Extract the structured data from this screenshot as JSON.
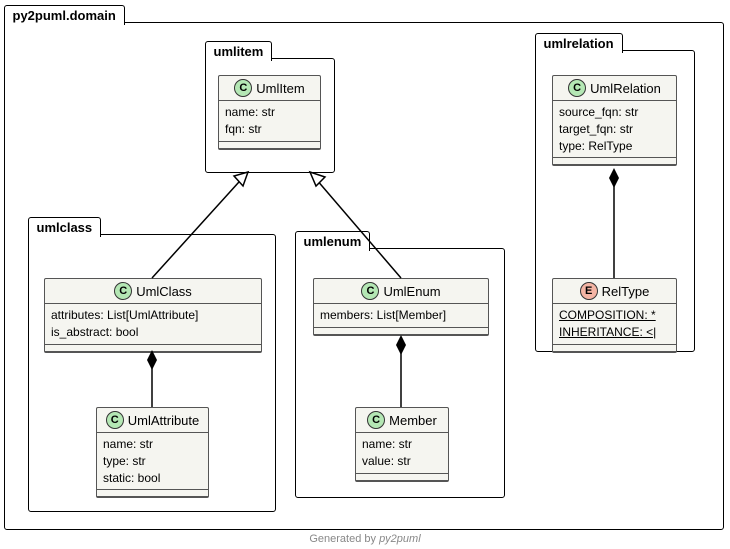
{
  "chart_data": {
    "type": "uml_class_diagram",
    "outer_package": "py2puml.domain",
    "packages": [
      {
        "name": "umlitem",
        "classes": [
          "UmlItem"
        ]
      },
      {
        "name": "umlclass",
        "classes": [
          "UmlClass",
          "UmlAttribute"
        ]
      },
      {
        "name": "umlenum",
        "classes": [
          "UmlEnum",
          "Member"
        ]
      },
      {
        "name": "umlrelation",
        "classes": [
          "UmlRelation",
          "RelType"
        ]
      }
    ],
    "classes": {
      "UmlItem": {
        "stereotype": "C",
        "attributes": [
          "name: str",
          "fqn: str"
        ]
      },
      "UmlClass": {
        "stereotype": "C",
        "attributes": [
          "attributes: List[UmlAttribute]",
          "is_abstract: bool"
        ]
      },
      "UmlAttribute": {
        "stereotype": "C",
        "attributes": [
          "name: str",
          "type: str",
          "static: bool"
        ]
      },
      "UmlEnum": {
        "stereotype": "C",
        "attributes": [
          "members: List[Member]"
        ]
      },
      "Member": {
        "stereotype": "C",
        "attributes": [
          "name: str",
          "value: str"
        ]
      },
      "UmlRelation": {
        "stereotype": "C",
        "attributes": [
          "source_fqn: str",
          "target_fqn: str",
          "type: RelType"
        ]
      },
      "RelType": {
        "stereotype": "E",
        "enum_values": [
          "COMPOSITION: *",
          "INHERITANCE: <|"
        ]
      }
    },
    "relations": [
      {
        "from": "UmlClass",
        "to": "UmlItem",
        "type": "inheritance"
      },
      {
        "from": "UmlEnum",
        "to": "UmlItem",
        "type": "inheritance"
      },
      {
        "from": "UmlClass",
        "to": "UmlAttribute",
        "type": "composition"
      },
      {
        "from": "UmlEnum",
        "to": "Member",
        "type": "composition"
      },
      {
        "from": "UmlRelation",
        "to": "RelType",
        "type": "composition"
      }
    ]
  },
  "outer": {
    "label": "py2puml.domain"
  },
  "umlitem": {
    "label": "umlitem",
    "cls": {
      "name": "UmlItem",
      "a0": "name: str",
      "a1": "fqn: str"
    }
  },
  "umlclass": {
    "label": "umlclass",
    "cls": {
      "name": "UmlClass",
      "a0": "attributes: List[UmlAttribute]",
      "a1": "is_abstract: bool"
    },
    "attr": {
      "name": "UmlAttribute",
      "a0": "name: str",
      "a1": "type: str",
      "a2": "static: bool"
    }
  },
  "umlenum": {
    "label": "umlenum",
    "cls": {
      "name": "UmlEnum",
      "a0": "members: List[Member]"
    },
    "member": {
      "name": "Member",
      "a0": "name: str",
      "a1": "value: str"
    }
  },
  "umlrelation": {
    "label": "umlrelation",
    "cls": {
      "name": "UmlRelation",
      "a0": "source_fqn: str",
      "a1": "target_fqn: str",
      "a2": "type: RelType"
    },
    "enum": {
      "name": "RelType",
      "v0": "COMPOSITION: *",
      "v1": "INHERITANCE: <|"
    }
  },
  "footer": {
    "prefix": "Generated by ",
    "tool": "py2puml"
  }
}
